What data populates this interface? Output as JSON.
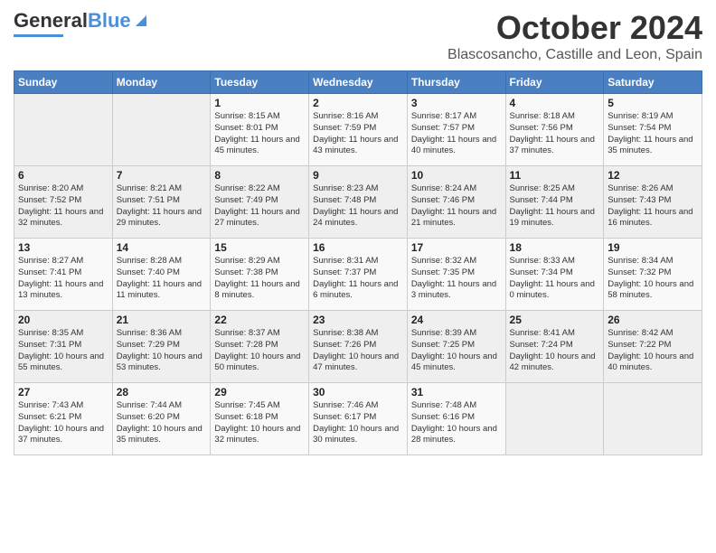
{
  "header": {
    "logo_general": "General",
    "logo_blue": "Blue",
    "month_title": "October 2024",
    "location": "Blascosancho, Castille and Leon, Spain"
  },
  "weekdays": [
    "Sunday",
    "Monday",
    "Tuesday",
    "Wednesday",
    "Thursday",
    "Friday",
    "Saturday"
  ],
  "weeks": [
    [
      null,
      null,
      {
        "day": 1,
        "sunrise": "Sunrise: 8:15 AM",
        "sunset": "Sunset: 8:01 PM",
        "daylight": "Daylight: 11 hours and 45 minutes."
      },
      {
        "day": 2,
        "sunrise": "Sunrise: 8:16 AM",
        "sunset": "Sunset: 7:59 PM",
        "daylight": "Daylight: 11 hours and 43 minutes."
      },
      {
        "day": 3,
        "sunrise": "Sunrise: 8:17 AM",
        "sunset": "Sunset: 7:57 PM",
        "daylight": "Daylight: 11 hours and 40 minutes."
      },
      {
        "day": 4,
        "sunrise": "Sunrise: 8:18 AM",
        "sunset": "Sunset: 7:56 PM",
        "daylight": "Daylight: 11 hours and 37 minutes."
      },
      {
        "day": 5,
        "sunrise": "Sunrise: 8:19 AM",
        "sunset": "Sunset: 7:54 PM",
        "daylight": "Daylight: 11 hours and 35 minutes."
      }
    ],
    [
      {
        "day": 6,
        "sunrise": "Sunrise: 8:20 AM",
        "sunset": "Sunset: 7:52 PM",
        "daylight": "Daylight: 11 hours and 32 minutes."
      },
      {
        "day": 7,
        "sunrise": "Sunrise: 8:21 AM",
        "sunset": "Sunset: 7:51 PM",
        "daylight": "Daylight: 11 hours and 29 minutes."
      },
      {
        "day": 8,
        "sunrise": "Sunrise: 8:22 AM",
        "sunset": "Sunset: 7:49 PM",
        "daylight": "Daylight: 11 hours and 27 minutes."
      },
      {
        "day": 9,
        "sunrise": "Sunrise: 8:23 AM",
        "sunset": "Sunset: 7:48 PM",
        "daylight": "Daylight: 11 hours and 24 minutes."
      },
      {
        "day": 10,
        "sunrise": "Sunrise: 8:24 AM",
        "sunset": "Sunset: 7:46 PM",
        "daylight": "Daylight: 11 hours and 21 minutes."
      },
      {
        "day": 11,
        "sunrise": "Sunrise: 8:25 AM",
        "sunset": "Sunset: 7:44 PM",
        "daylight": "Daylight: 11 hours and 19 minutes."
      },
      {
        "day": 12,
        "sunrise": "Sunrise: 8:26 AM",
        "sunset": "Sunset: 7:43 PM",
        "daylight": "Daylight: 11 hours and 16 minutes."
      }
    ],
    [
      {
        "day": 13,
        "sunrise": "Sunrise: 8:27 AM",
        "sunset": "Sunset: 7:41 PM",
        "daylight": "Daylight: 11 hours and 13 minutes."
      },
      {
        "day": 14,
        "sunrise": "Sunrise: 8:28 AM",
        "sunset": "Sunset: 7:40 PM",
        "daylight": "Daylight: 11 hours and 11 minutes."
      },
      {
        "day": 15,
        "sunrise": "Sunrise: 8:29 AM",
        "sunset": "Sunset: 7:38 PM",
        "daylight": "Daylight: 11 hours and 8 minutes."
      },
      {
        "day": 16,
        "sunrise": "Sunrise: 8:31 AM",
        "sunset": "Sunset: 7:37 PM",
        "daylight": "Daylight: 11 hours and 6 minutes."
      },
      {
        "day": 17,
        "sunrise": "Sunrise: 8:32 AM",
        "sunset": "Sunset: 7:35 PM",
        "daylight": "Daylight: 11 hours and 3 minutes."
      },
      {
        "day": 18,
        "sunrise": "Sunrise: 8:33 AM",
        "sunset": "Sunset: 7:34 PM",
        "daylight": "Daylight: 11 hours and 0 minutes."
      },
      {
        "day": 19,
        "sunrise": "Sunrise: 8:34 AM",
        "sunset": "Sunset: 7:32 PM",
        "daylight": "Daylight: 10 hours and 58 minutes."
      }
    ],
    [
      {
        "day": 20,
        "sunrise": "Sunrise: 8:35 AM",
        "sunset": "Sunset: 7:31 PM",
        "daylight": "Daylight: 10 hours and 55 minutes."
      },
      {
        "day": 21,
        "sunrise": "Sunrise: 8:36 AM",
        "sunset": "Sunset: 7:29 PM",
        "daylight": "Daylight: 10 hours and 53 minutes."
      },
      {
        "day": 22,
        "sunrise": "Sunrise: 8:37 AM",
        "sunset": "Sunset: 7:28 PM",
        "daylight": "Daylight: 10 hours and 50 minutes."
      },
      {
        "day": 23,
        "sunrise": "Sunrise: 8:38 AM",
        "sunset": "Sunset: 7:26 PM",
        "daylight": "Daylight: 10 hours and 47 minutes."
      },
      {
        "day": 24,
        "sunrise": "Sunrise: 8:39 AM",
        "sunset": "Sunset: 7:25 PM",
        "daylight": "Daylight: 10 hours and 45 minutes."
      },
      {
        "day": 25,
        "sunrise": "Sunrise: 8:41 AM",
        "sunset": "Sunset: 7:24 PM",
        "daylight": "Daylight: 10 hours and 42 minutes."
      },
      {
        "day": 26,
        "sunrise": "Sunrise: 8:42 AM",
        "sunset": "Sunset: 7:22 PM",
        "daylight": "Daylight: 10 hours and 40 minutes."
      }
    ],
    [
      {
        "day": 27,
        "sunrise": "Sunrise: 7:43 AM",
        "sunset": "Sunset: 6:21 PM",
        "daylight": "Daylight: 10 hours and 37 minutes."
      },
      {
        "day": 28,
        "sunrise": "Sunrise: 7:44 AM",
        "sunset": "Sunset: 6:20 PM",
        "daylight": "Daylight: 10 hours and 35 minutes."
      },
      {
        "day": 29,
        "sunrise": "Sunrise: 7:45 AM",
        "sunset": "Sunset: 6:18 PM",
        "daylight": "Daylight: 10 hours and 32 minutes."
      },
      {
        "day": 30,
        "sunrise": "Sunrise: 7:46 AM",
        "sunset": "Sunset: 6:17 PM",
        "daylight": "Daylight: 10 hours and 30 minutes."
      },
      {
        "day": 31,
        "sunrise": "Sunrise: 7:48 AM",
        "sunset": "Sunset: 6:16 PM",
        "daylight": "Daylight: 10 hours and 28 minutes."
      },
      null,
      null
    ]
  ]
}
